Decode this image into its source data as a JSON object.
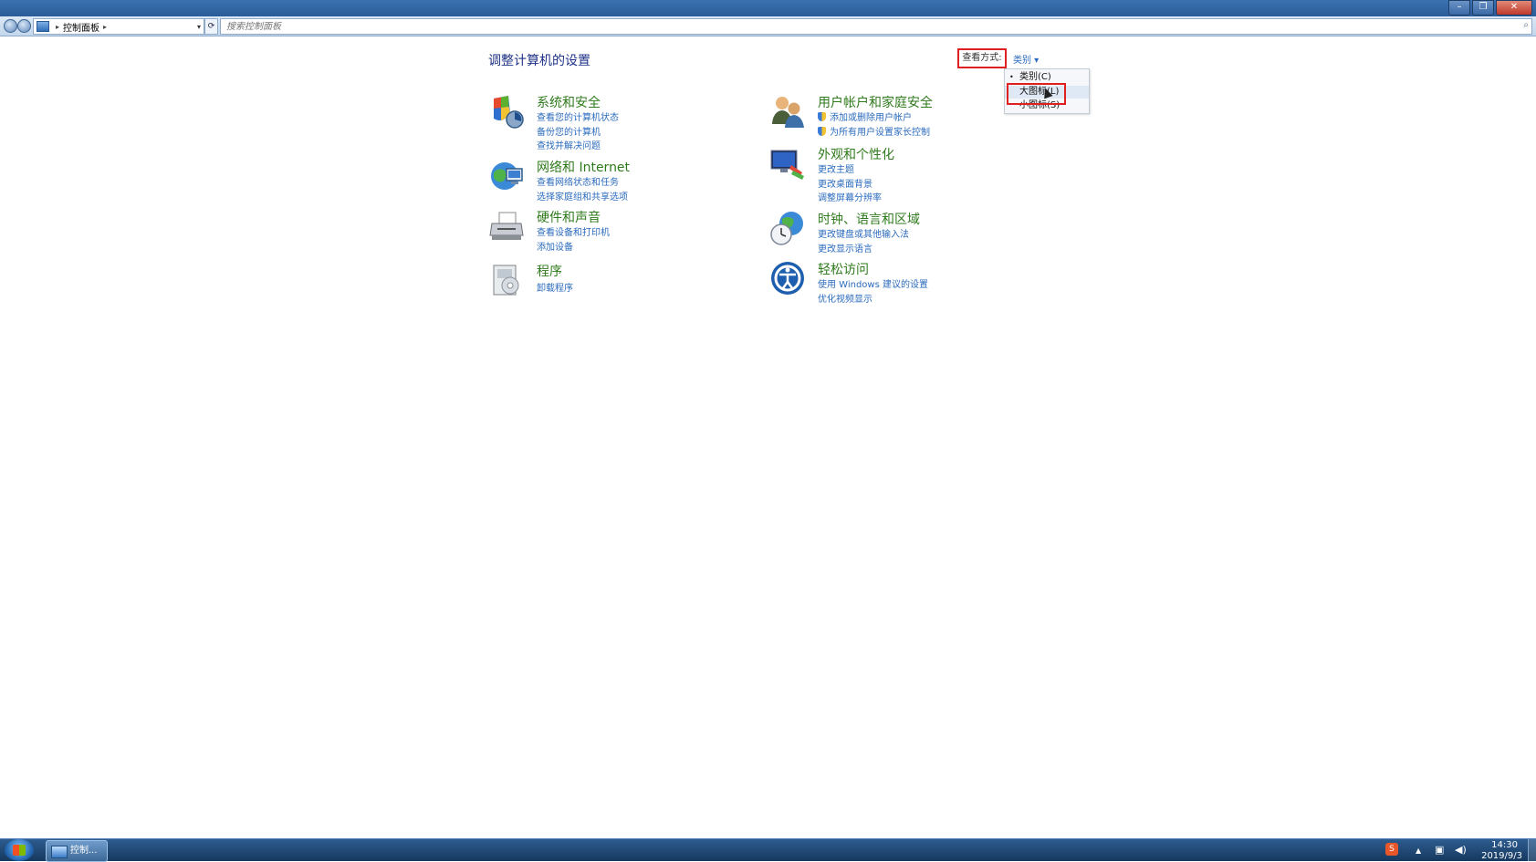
{
  "window": {
    "minimize_glyph": "–",
    "restore_glyph": "❐",
    "close_glyph": "✕"
  },
  "address_bar": {
    "breadcrumb_sep": "▸",
    "location": "控制面板",
    "search_placeholder": "搜索控制面板"
  },
  "main": {
    "title": "调整计算机的设置",
    "view_by_label": "查看方式:",
    "view_by_value": "类别 ▾",
    "view_menu": {
      "items": [
        {
          "label": "类别(C)",
          "selected": true
        },
        {
          "label": "大图标(L)",
          "hovered": true
        },
        {
          "label": "小图标(S)"
        }
      ],
      "bullet": "•"
    }
  },
  "categories": [
    {
      "icon": "shield-computer-icon",
      "name": "系统和安全",
      "links": [
        "查看您的计算机状态",
        "备份您的计算机",
        "查找并解决问题"
      ]
    },
    {
      "icon": "network-globe-icon",
      "name": "网络和 Internet",
      "links": [
        "查看网络状态和任务",
        "选择家庭组和共享选项"
      ]
    },
    {
      "icon": "printer-icon",
      "name": "硬件和声音",
      "links": [
        "查看设备和打印机",
        "添加设备"
      ]
    },
    {
      "icon": "programs-icon",
      "name": "程序",
      "links": [
        "卸载程序"
      ]
    },
    {
      "icon": "users-icon",
      "name": "用户帐户和家庭安全",
      "links": [
        "添加或删除用户帐户",
        "为所有用户设置家长控制"
      ]
    },
    {
      "icon": "monitor-paint-icon",
      "name": "外观和个性化",
      "links": [
        "更改主题",
        "更改桌面背景",
        "调整屏幕分辨率"
      ]
    },
    {
      "icon": "clock-globe-icon",
      "name": "时钟、语言和区域",
      "links": [
        "更改键盘或其他输入法",
        "更改显示语言"
      ]
    },
    {
      "icon": "ease-of-access-icon",
      "name": "轻松访问",
      "links": [
        "使用 Windows 建议的设置",
        "优化视频显示"
      ]
    }
  ],
  "taskbar": {
    "task_label": "控制...",
    "ime_label": "S",
    "tray_up": "▲",
    "network_glyph": "▣",
    "volume_glyph": "◀)",
    "time": "14:30",
    "date": "2019/9/3"
  }
}
